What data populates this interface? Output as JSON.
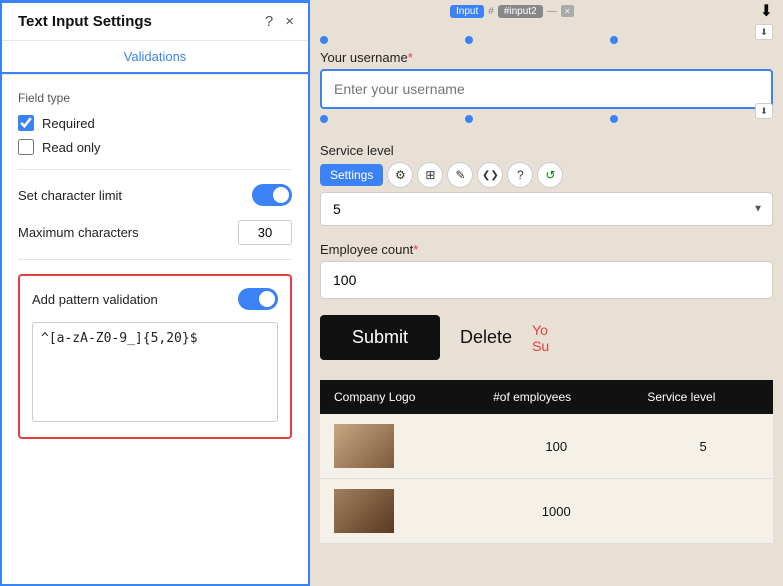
{
  "panel": {
    "title": "Text Input Settings",
    "help_icon": "?",
    "close_icon": "×",
    "tabs": [
      {
        "label": "Validations",
        "active": true
      }
    ],
    "field_type_label": "Field type",
    "required_label": "Required",
    "required_checked": true,
    "readonly_label": "Read only",
    "readonly_checked": false,
    "set_char_limit_label": "Set character limit",
    "char_limit_toggle": true,
    "max_chars_label": "Maximum characters",
    "max_chars_value": "30",
    "add_pattern_label": "Add pattern validation",
    "pattern_toggle": true,
    "pattern_value": "^[a-zA-Z0-9_]{5,20}$"
  },
  "form": {
    "node_bar": {
      "input_tag": "Input",
      "id_tag": "#input2",
      "connector": "—"
    },
    "username_label": "Your username",
    "username_required": "*",
    "username_placeholder": "Enter your username",
    "service_level_label": "Service level",
    "service_level_value": "5",
    "settings_btn": "Settings",
    "toolbar_icons": [
      "⚙",
      "⊞",
      "✎",
      "«»",
      "?",
      "↺"
    ],
    "employee_label": "Employee count",
    "employee_required": "*",
    "employee_value": "100",
    "submit_btn": "Submit",
    "delete_btn": "Delete",
    "side_text_line1": "Yo",
    "side_text_line2": "Su"
  },
  "table": {
    "headers": [
      "Company Logo",
      "#of employees",
      "Service level"
    ],
    "rows": [
      {
        "logo_color": "#8a7a6a",
        "employees": "100",
        "service": "5"
      },
      {
        "logo_color": "#6a5a4a",
        "employees": "1000",
        "service": ""
      }
    ]
  }
}
